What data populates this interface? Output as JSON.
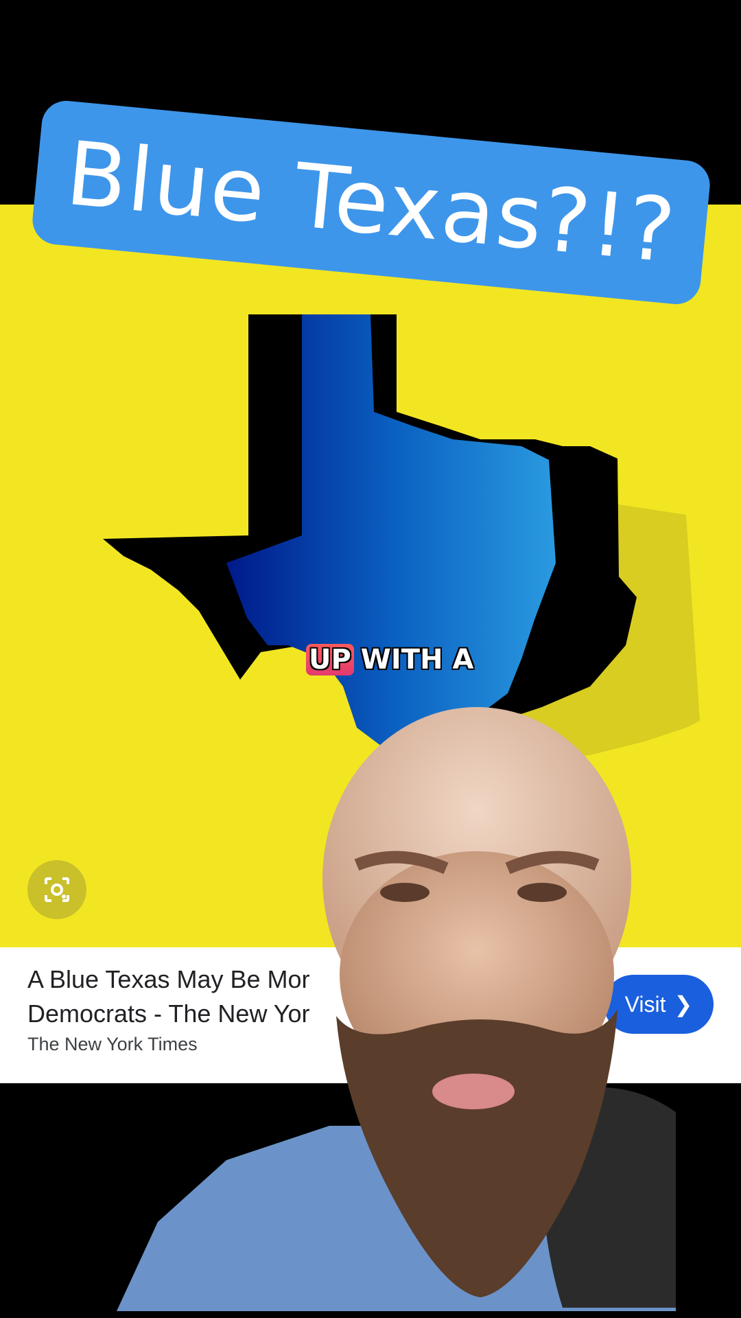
{
  "title": "Blue Texas?!?",
  "caption": {
    "highlight": "UP",
    "rest": "WITH A"
  },
  "card": {
    "title_line1": "A Blue Texas May Be Mor",
    "title_line2": "Democrats - The New Yor",
    "source": "The New York Times",
    "visit_label": "Visit",
    "visit_icon": "chevron-right-icon"
  },
  "lens_icon": "camera-lens-icon",
  "colors": {
    "yellow": "#f2e622",
    "banner": "#3e96ea",
    "visit": "#1a5fdd"
  }
}
